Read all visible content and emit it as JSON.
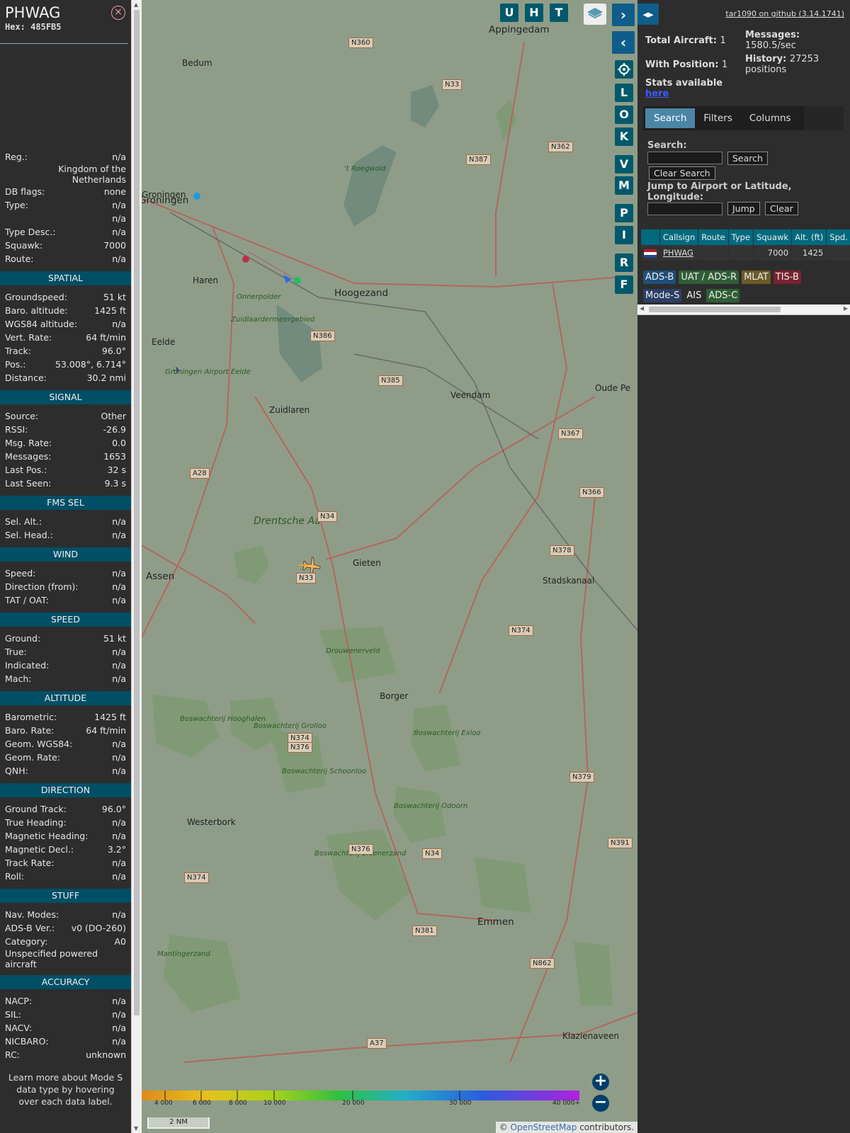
{
  "info": {
    "callsign": "PHWAG",
    "hex_label": "Hex:",
    "hex": "485FB5",
    "close_icon": "×",
    "top_rows": [
      {
        "k": "Reg.:",
        "v": "n/a"
      },
      {
        "k": "",
        "v": "Kingdom of the Netherlands"
      },
      {
        "k": "DB flags:",
        "v": "none"
      },
      {
        "k": "Type:",
        "v": "n/a"
      },
      {
        "k": "",
        "v": "n/a"
      },
      {
        "k": "Type Desc.:",
        "v": "n/a"
      },
      {
        "k": "Squawk:",
        "v": "7000"
      },
      {
        "k": "Route:",
        "v": "n/a"
      }
    ],
    "sections": [
      {
        "title": "SPATIAL",
        "rows": [
          {
            "k": "Groundspeed:",
            "v": "51 kt"
          },
          {
            "k": "Baro. altitude:",
            "v": "1425 ft"
          },
          {
            "k": "WGS84 altitude:",
            "v": "n/a"
          },
          {
            "k": "Vert. Rate:",
            "v": "64 ft/min"
          },
          {
            "k": "Track:",
            "v": "96.0°"
          },
          {
            "k": "Pos.:",
            "v": "53.008°, 6.714°"
          },
          {
            "k": "Distance:",
            "v": "30.2 nmi"
          }
        ]
      },
      {
        "title": "SIGNAL",
        "rows": [
          {
            "k": "Source:",
            "v": "Other"
          },
          {
            "k": "RSSI:",
            "v": "-26.9"
          },
          {
            "k": "Msg. Rate:",
            "v": "0.0"
          },
          {
            "k": "Messages:",
            "v": "1653"
          },
          {
            "k": "Last Pos.:",
            "v": "32 s"
          },
          {
            "k": "Last Seen:",
            "v": "9.3 s"
          }
        ]
      },
      {
        "title": "FMS SEL",
        "rows": [
          {
            "k": "Sel. Alt.:",
            "v": "n/a"
          },
          {
            "k": "Sel. Head.:",
            "v": "n/a"
          }
        ]
      },
      {
        "title": "WIND",
        "rows": [
          {
            "k": "Speed:",
            "v": "n/a"
          },
          {
            "k": "Direction (from):",
            "v": "n/a"
          },
          {
            "k": "TAT / OAT:",
            "v": "n/a"
          }
        ]
      },
      {
        "title": "SPEED",
        "rows": [
          {
            "k": "Ground:",
            "v": "51 kt"
          },
          {
            "k": "True:",
            "v": "n/a"
          },
          {
            "k": "Indicated:",
            "v": "n/a"
          },
          {
            "k": "Mach:",
            "v": "n/a"
          }
        ]
      },
      {
        "title": "ALTITUDE",
        "rows": [
          {
            "k": "Barometric:",
            "v": "1425 ft"
          },
          {
            "k": "Baro. Rate:",
            "v": "64 ft/min"
          },
          {
            "k": "Geom. WGS84:",
            "v": "n/a"
          },
          {
            "k": "Geom. Rate:",
            "v": "n/a"
          },
          {
            "k": "QNH:",
            "v": "n/a"
          }
        ]
      },
      {
        "title": "DIRECTION",
        "rows": [
          {
            "k": "Ground Track:",
            "v": "96.0°"
          },
          {
            "k": "True Heading:",
            "v": "n/a"
          },
          {
            "k": "Magnetic Heading:",
            "v": "n/a"
          },
          {
            "k": "Magnetic Decl.:",
            "v": "3.2°"
          },
          {
            "k": "Track Rate:",
            "v": "n/a"
          },
          {
            "k": "Roll:",
            "v": "n/a"
          }
        ]
      },
      {
        "title": "STUFF",
        "rows": [
          {
            "k": "Nav. Modes:",
            "v": "n/a"
          },
          {
            "k": "ADS-B Ver.:",
            "v": "v0 (DO-260)"
          },
          {
            "k": "Category:",
            "v": "A0"
          },
          {
            "k": "Unspecified powered aircraft",
            "v": ""
          }
        ]
      },
      {
        "title": "ACCURACY",
        "rows": [
          {
            "k": "NACP:",
            "v": "n/a"
          },
          {
            "k": "SIL:",
            "v": "n/a"
          },
          {
            "k": "NACV:",
            "v": "n/a"
          },
          {
            "k": "NICBARO:",
            "v": "n/a"
          },
          {
            "k": "RC:",
            "v": "unknown"
          }
        ]
      }
    ],
    "footer": "Learn more about Mode S data type by hovering over each data label."
  },
  "map": {
    "buttons_top": [
      "U",
      "H",
      "T"
    ],
    "buttons_side": [
      "L",
      "O",
      "K",
      "V",
      "M",
      "P",
      "I",
      "R",
      "F"
    ],
    "nav_forward": "›",
    "nav_back": "‹",
    "settings_icon": "gear-icon",
    "layers_icon": "layers-icon",
    "zoom_in": "+",
    "zoom_out": "−",
    "scale_label": "2 NM",
    "alt_ticks": [
      "4 000",
      "6 000",
      "8 000",
      "10 000",
      "20 000",
      "30 000",
      "40 000+"
    ],
    "attribution_prefix": "©",
    "attribution_link": "OpenStreetMap",
    "attribution_suffix": "contributors.",
    "places": [
      "Appingedam",
      "Bedum",
      "Groningen",
      "Haren",
      "Hoogezand",
      "Eelde",
      "Groningen Airport Eelde",
      "Zuidlaren",
      "Veendam",
      "Oude Pe",
      "Onnerpolder",
      "Zuidlaardermeergebied",
      "Drentsche Aa",
      "Assen",
      "Gieten",
      "Stadskanaal",
      "Drouwenerveld",
      "Borger",
      "Boswachterij Hooghalen",
      "Boswachterij Grolloo",
      "Boswachterij Schoonloo",
      "Boswachterij Exloo",
      "Boswachterij Odoorn",
      "Westerbork",
      "Boswachterij Sleenerzand",
      "Emmen",
      "Mantingerzand",
      "Klazienaveen",
      "'t Roegwold",
      "Groningen"
    ],
    "roads": [
      "N360",
      "N33",
      "N387",
      "N362",
      "N386",
      "N385",
      "N367",
      "N366",
      "A28",
      "N34",
      "N33",
      "N378",
      "N374",
      "N374",
      "N376",
      "N379",
      "N376",
      "N34",
      "N391",
      "N374",
      "N381",
      "N862",
      "A37"
    ]
  },
  "sidebar": {
    "gh_link": "tar1090 on github (3.14.1741)",
    "collapse_icon": "◂▸",
    "total_label": "Total Aircraft:",
    "total_value": "1",
    "messages_label": "Messages:",
    "messages_value": "1580.5/sec",
    "position_label": "With Position:",
    "position_value": "1",
    "history_label": "History:",
    "history_value": "27253 positions",
    "stats_label": "Stats available",
    "stats_link": "here",
    "tabs": [
      "Search",
      "Filters",
      "Columns"
    ],
    "search_label": "Search:",
    "search_value": "",
    "search_button": "Search",
    "clear_search_button": "Clear Search",
    "jump_label": "Jump to Airport or Latitude, Longitude:",
    "jump_value": "",
    "jump_button": "Jump",
    "clear_button": "Clear",
    "table_headers": [
      "",
      "Callsign",
      "Route",
      "Type",
      "Squawk",
      "Alt. (ft)",
      "Spd."
    ],
    "table_rows": [
      {
        "flag": "netherlands-flag",
        "callsign": "PHWAG",
        "route": "",
        "type": "",
        "squawk": "7000",
        "alt": "1425",
        "spd": ""
      }
    ],
    "badges": [
      {
        "label": "ADS-B",
        "color": "#1e4f7a"
      },
      {
        "label": "UAT / ADS-R",
        "color": "#2f5e36"
      },
      {
        "label": "MLAT",
        "color": "#6d5a28"
      },
      {
        "label": "TIS-B",
        "color": "#7a2230"
      },
      {
        "label": "Mode-S",
        "color": "#2c3f66"
      },
      {
        "label": "AIS",
        "color": "#2d2d2d"
      },
      {
        "label": "ADS-C",
        "color": "#2f5e36"
      }
    ]
  },
  "colors": {
    "accent": "#00596b",
    "section_header": "#004f66",
    "panel_bg": "#2d2d2d",
    "map_tint": "#8d9c86"
  }
}
